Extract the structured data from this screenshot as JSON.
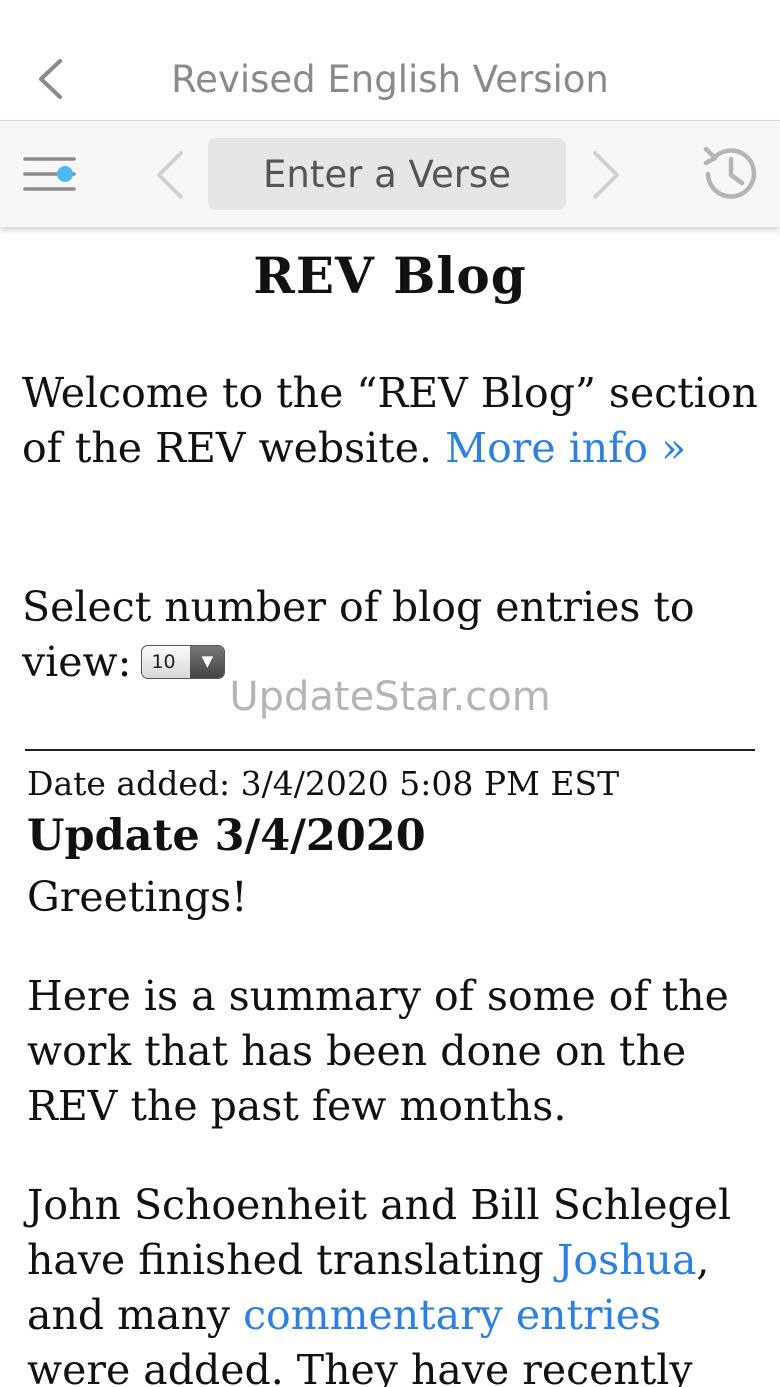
{
  "nav": {
    "title": "Revised English Version",
    "back_icon": "chevron-left-icon"
  },
  "toolbar": {
    "menu_icon": "menu-toggle-icon",
    "prev_icon": "chevron-left-icon",
    "verse_placeholder": "Enter a Verse",
    "next_icon": "chevron-right-icon",
    "history_icon": "history-clock-icon"
  },
  "page": {
    "title": "REV Blog",
    "welcome_text": "Welcome to the “REV Blog” section of the REV website.",
    "more_info_link": "More info »",
    "select_label": "Select number of blog entries to view:",
    "entries_count_selected": "10",
    "watermark": "UpdateStar.com"
  },
  "entry": {
    "date_added": "Date added: 3/4/2020 5:08 PM EST",
    "title": "Update 3/4/2020",
    "greeting": "Greetings!",
    "paragraph1": "Here is a summary of some of the work that has been done on the REV the past few months.",
    "p2_part1": "John Schoenheit and Bill Schlegel have finished translating",
    "p2_link1": "Joshua",
    "p2_part2": ", and many",
    "p2_link2": "commentary entries",
    "p2_part3": "were added. They have recently"
  },
  "colors": {
    "link": "#2f7fe0",
    "nav_title": "#8a8a8a",
    "toolbar_bg": "#f7f7f7",
    "menu_dot": "#4fb8f0"
  }
}
